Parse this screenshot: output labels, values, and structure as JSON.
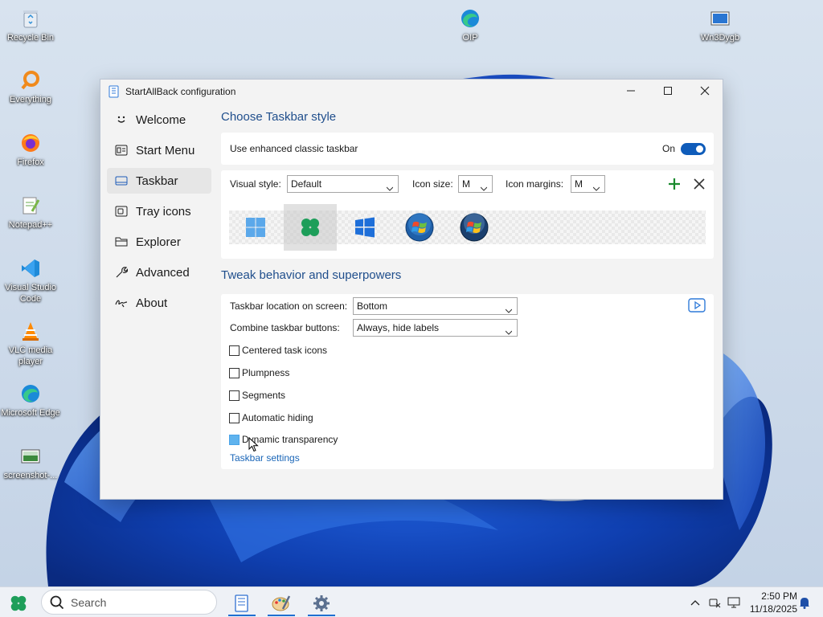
{
  "desktop": {
    "icons": [
      {
        "label": "Recycle Bin",
        "icon": "recycle-bin-icon"
      },
      {
        "label": "Everything",
        "icon": "everything-search-icon"
      },
      {
        "label": "Firefox",
        "icon": "firefox-icon"
      },
      {
        "label": "Notepad++",
        "icon": "notepad-plus-plus-icon"
      },
      {
        "label": "Visual Studio Code",
        "icon": "vscode-icon"
      },
      {
        "label": "VLC media player",
        "icon": "vlc-icon"
      },
      {
        "label": "Microsoft Edge",
        "icon": "edge-icon"
      },
      {
        "label": "screenshot-...",
        "icon": "image-file-icon"
      },
      {
        "label": "OIP",
        "icon": "edge-file-icon"
      },
      {
        "label": "Wn3Dygb",
        "icon": "image-file-icon"
      }
    ]
  },
  "window": {
    "title": "StartAllBack configuration"
  },
  "sidebar": {
    "items": [
      {
        "label": "Welcome",
        "icon": "smiley-icon"
      },
      {
        "label": "Start Menu",
        "icon": "start-menu-icon"
      },
      {
        "label": "Taskbar",
        "icon": "taskbar-icon",
        "active": true
      },
      {
        "label": "Tray icons",
        "icon": "tray-icon"
      },
      {
        "label": "Explorer",
        "icon": "folder-icon"
      },
      {
        "label": "Advanced",
        "icon": "wrench-icon"
      },
      {
        "label": "About",
        "icon": "signature-icon"
      }
    ]
  },
  "taskbar_style": {
    "heading": "Choose Taskbar style",
    "enhanced_label": "Use enhanced classic taskbar",
    "enhanced_state": "On",
    "visual_style_label": "Visual style:",
    "visual_style_value": "Default",
    "icon_size_label": "Icon size:",
    "icon_size_value": "M",
    "icon_margins_label": "Icon margins:",
    "icon_margins_value": "M",
    "styles": [
      "windows-11-logo",
      "clover-logo",
      "windows-10-logo",
      "windows-7-orb",
      "windows-vista-orb"
    ],
    "selected_style": 1
  },
  "tweaks": {
    "heading": "Tweak behavior and superpowers",
    "location_label": "Taskbar location on screen:",
    "location_value": "Bottom",
    "combine_label": "Combine taskbar buttons:",
    "combine_value": "Always, hide labels",
    "checkboxes": [
      {
        "label": "Centered task icons",
        "checked": false
      },
      {
        "label": "Plumpness",
        "checked": false
      },
      {
        "label": "Segments",
        "checked": false
      },
      {
        "label": "Automatic hiding",
        "checked": false
      },
      {
        "label": "Dynamic transparency",
        "checked": false
      }
    ],
    "settings_link": "Taskbar settings"
  },
  "taskbar": {
    "search_placeholder": "Search",
    "time": "2:50 PM",
    "date": "11/18/2025"
  },
  "colors": {
    "accent": "#0f5cba",
    "heading": "#1f4e8c",
    "link": "#1a66b8",
    "add": "#1a8a2e"
  }
}
